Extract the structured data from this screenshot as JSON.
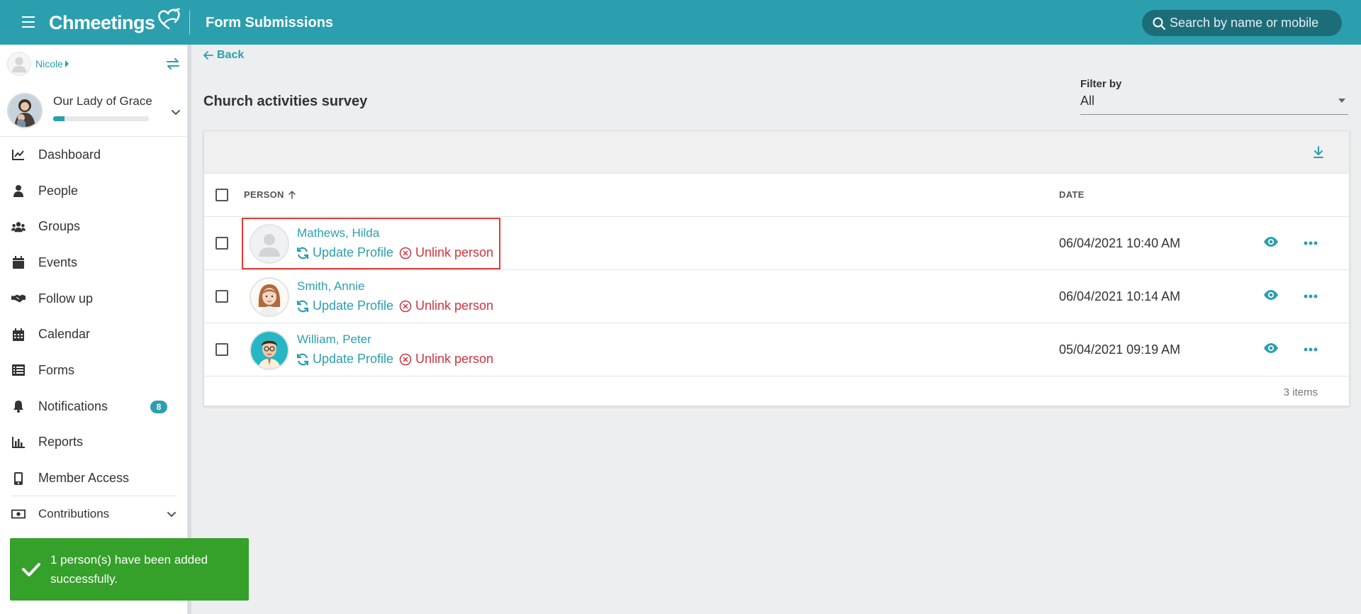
{
  "app": {
    "brand": "Chmeetings",
    "page_title": "Form Submissions",
    "search_placeholder": "Search by name or mobile"
  },
  "sidebar": {
    "user_name": "Nicole",
    "org_name": "Our Lady of Grace",
    "org_progress": 0.12,
    "items": [
      {
        "label": "Dashboard",
        "icon": "chart-line-icon"
      },
      {
        "label": "People",
        "icon": "person-icon"
      },
      {
        "label": "Groups",
        "icon": "users-icon"
      },
      {
        "label": "Events",
        "icon": "calendar-icon"
      },
      {
        "label": "Follow up",
        "icon": "handshake-icon"
      },
      {
        "label": "Calendar",
        "icon": "calendar-grid-icon"
      },
      {
        "label": "Forms",
        "icon": "list-icon"
      },
      {
        "label": "Notifications",
        "icon": "bell-icon",
        "badge": "8"
      },
      {
        "label": "Reports",
        "icon": "bar-chart-icon"
      },
      {
        "label": "Member Access",
        "icon": "mobile-icon"
      },
      {
        "label": "Contributions",
        "icon": "money-icon"
      }
    ]
  },
  "toast": {
    "message": "1 person(s) have been added successfully."
  },
  "main": {
    "back_label": "Back",
    "form_title": "Church activities survey",
    "filter_label": "Filter by",
    "filter_value": "All",
    "columns": {
      "person": "PERSON",
      "date": "DATE"
    },
    "update_label": "Update Profile",
    "unlink_label": "Unlink person",
    "rows": [
      {
        "name": "Mathews, Hilda",
        "date": "06/04/2021 10:40 AM",
        "avatar": "default-avatar",
        "highlighted": true
      },
      {
        "name": "Smith, Annie",
        "date": "06/04/2021 10:14 AM",
        "avatar": "female-avatar",
        "highlighted": false
      },
      {
        "name": "William, Peter",
        "date": "05/04/2021 09:19 AM",
        "avatar": "male-avatar",
        "highlighted": false
      }
    ],
    "footer": "3 items"
  },
  "colors": {
    "primary": "#2b9fae",
    "danger": "#d0343e",
    "success": "#35a02a"
  }
}
